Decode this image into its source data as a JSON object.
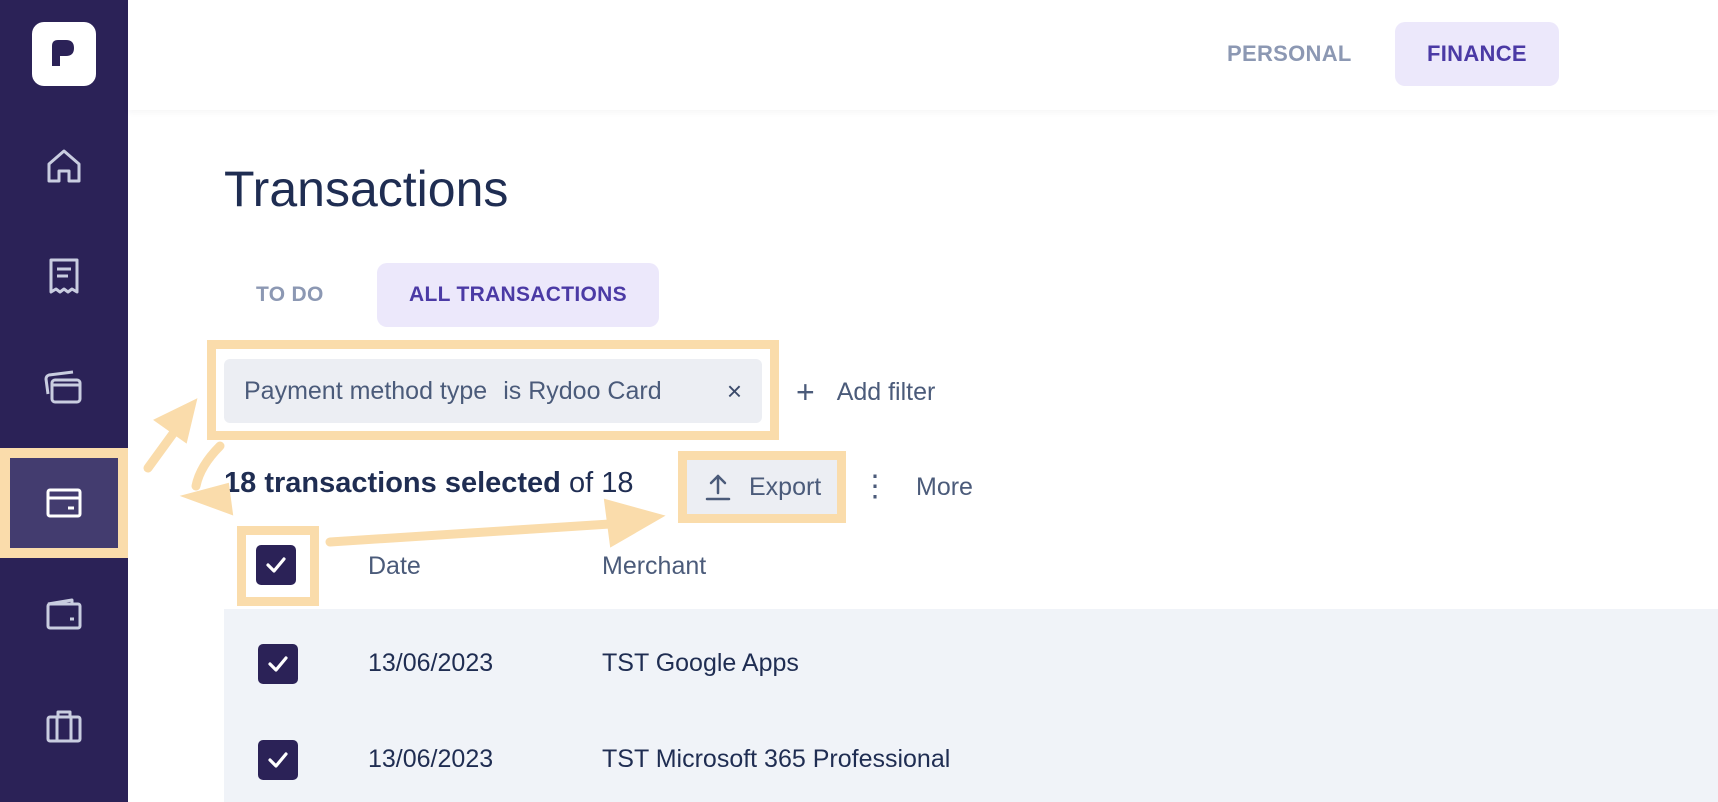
{
  "colors": {
    "sidebar_bg": "#2b2257",
    "accent": "#4b3aa5",
    "accent_bg": "#ece8fb",
    "highlight": "#fadcab"
  },
  "sidebar": {
    "logo_icon": "rydoo-logo-icon",
    "items": [
      {
        "icon": "home-icon"
      },
      {
        "icon": "receipt-icon"
      },
      {
        "icon": "cards-icon"
      },
      {
        "icon": "card-transactions-icon",
        "active": true
      },
      {
        "icon": "wallet-icon"
      },
      {
        "icon": "briefcase-icon"
      }
    ]
  },
  "header": {
    "roles": [
      "PERSONAL",
      "FINANCE"
    ],
    "active_role": "FINANCE"
  },
  "main": {
    "title": "Transactions",
    "tabs": [
      {
        "label": "TO DO"
      },
      {
        "label": "ALL TRANSACTIONS",
        "active": true
      }
    ],
    "filter": {
      "field": "Payment method type",
      "value": "is Rydoo Card",
      "close": "×"
    },
    "add_filter_plus": "+",
    "add_filter_label": "Add filter",
    "selection": {
      "selected_text": "18 transactions selected",
      "total_text": "of 18"
    },
    "export_label": "Export",
    "more_dots": "⋮",
    "more_label": "More",
    "table": {
      "columns": [
        "Date",
        "Merchant"
      ],
      "rows": [
        {
          "date": "13/06/2023",
          "merchant": "TST Google Apps",
          "checked": true
        },
        {
          "date": "13/06/2023",
          "merchant": "TST Microsoft 365 Professional",
          "checked": true
        }
      ]
    }
  }
}
